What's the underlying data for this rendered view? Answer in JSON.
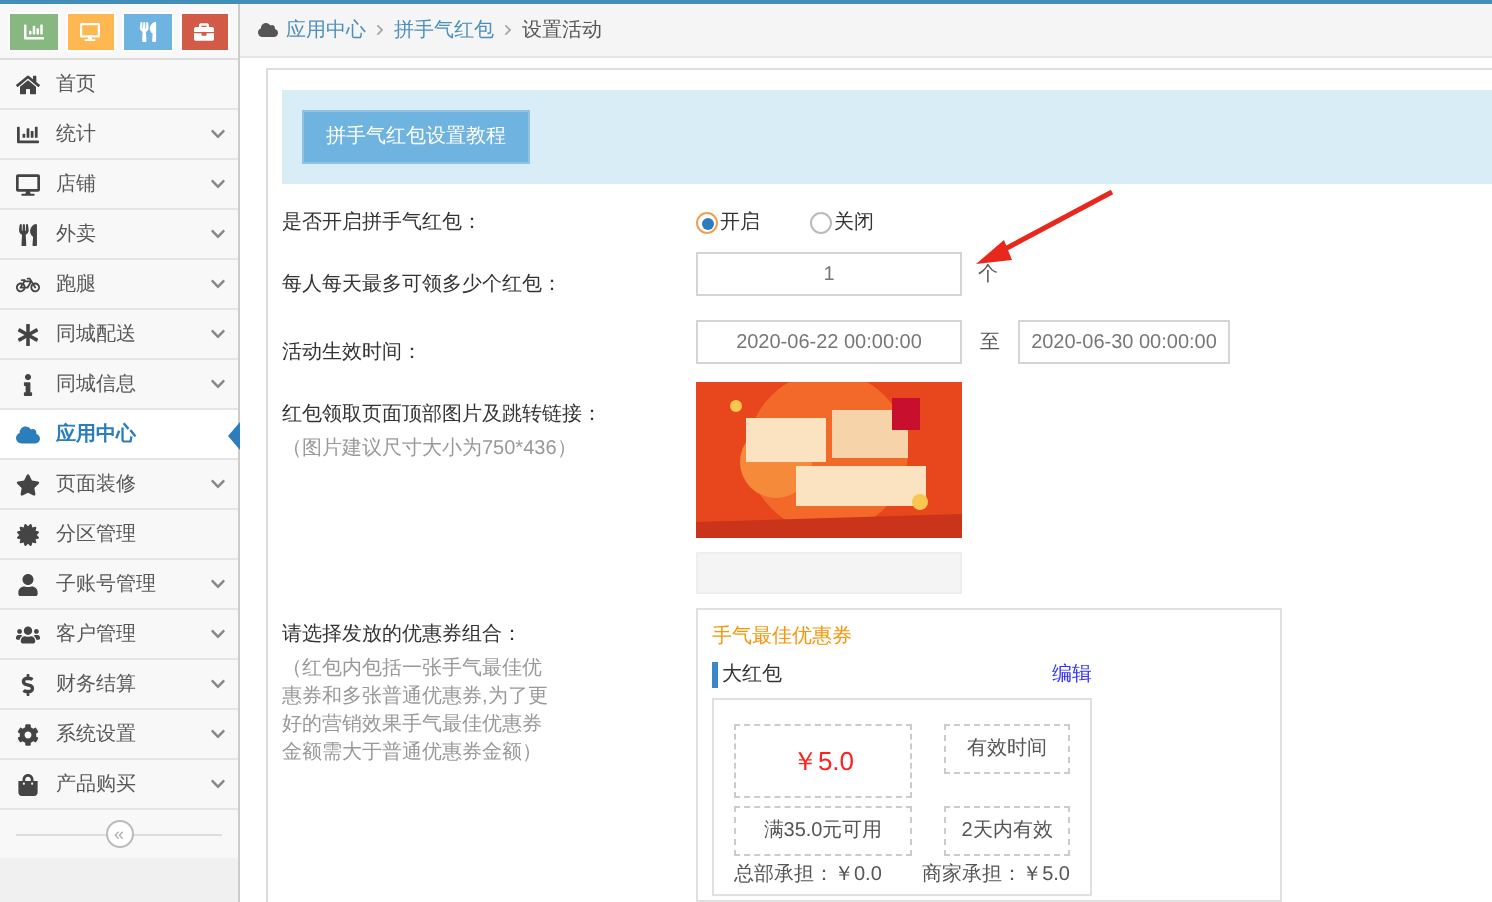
{
  "shortcuts": [
    {
      "color": "#87b87f"
    },
    {
      "color": "#ffb752"
    },
    {
      "color": "#6fb3e0"
    },
    {
      "color": "#d15b47"
    }
  ],
  "sidebar": {
    "items": [
      {
        "label": "首页",
        "expandable": false,
        "selected": false
      },
      {
        "label": "统计",
        "expandable": true,
        "selected": false
      },
      {
        "label": "店铺",
        "expandable": true,
        "selected": false
      },
      {
        "label": "外卖",
        "expandable": true,
        "selected": false
      },
      {
        "label": "跑腿",
        "expandable": true,
        "selected": false
      },
      {
        "label": "同城配送",
        "expandable": true,
        "selected": false
      },
      {
        "label": "同城信息",
        "expandable": true,
        "selected": false
      },
      {
        "label": "应用中心",
        "expandable": false,
        "selected": true
      },
      {
        "label": "页面装修",
        "expandable": true,
        "selected": false
      },
      {
        "label": "分区管理",
        "expandable": false,
        "selected": false
      },
      {
        "label": "子账号管理",
        "expandable": true,
        "selected": false
      },
      {
        "label": "客户管理",
        "expandable": true,
        "selected": false
      },
      {
        "label": "财务结算",
        "expandable": true,
        "selected": false
      },
      {
        "label": "系统设置",
        "expandable": true,
        "selected": false
      },
      {
        "label": "产品购买",
        "expandable": true,
        "selected": false
      }
    ],
    "collapse": "«"
  },
  "breadcrumb": [
    "应用中心",
    "拼手气红包",
    "设置活动"
  ],
  "tutorial_button": "拼手气红包设置教程",
  "form": {
    "enable": {
      "label": "是否开启拼手气红包：",
      "options": [
        {
          "label": "开启",
          "selected": true
        },
        {
          "label": "关闭",
          "selected": false
        }
      ]
    },
    "daily_limit": {
      "label": "每人每天最多可领多少个红包：",
      "value": "1",
      "unit": "个"
    },
    "period": {
      "label": "活动生效时间：",
      "start": "2020-06-22 00:00:00",
      "separator": "至",
      "end": "2020-06-30 00:00:00"
    },
    "banner": {
      "label": "红包领取页面顶部图片及跳转链接：",
      "hint": "（图片建议尺寸大小为750*436）"
    },
    "coupons": {
      "label": "请选择发放的优惠券组合：",
      "hint": "（红包内包括一张手气最佳优惠券和多张普通优惠券,为了更好的营销效果手气最佳优惠券金额需大于普通优惠券金额）",
      "title": "手气最佳优惠券",
      "name": "大红包",
      "edit": "编辑",
      "amount": "￥5.0",
      "condition": "满35.0元可用",
      "validity_label": "有效时间",
      "validity": "2天内有效",
      "hq_share": "总部承担：￥0.0",
      "merchant_share": "商家承担：￥5.0"
    }
  }
}
